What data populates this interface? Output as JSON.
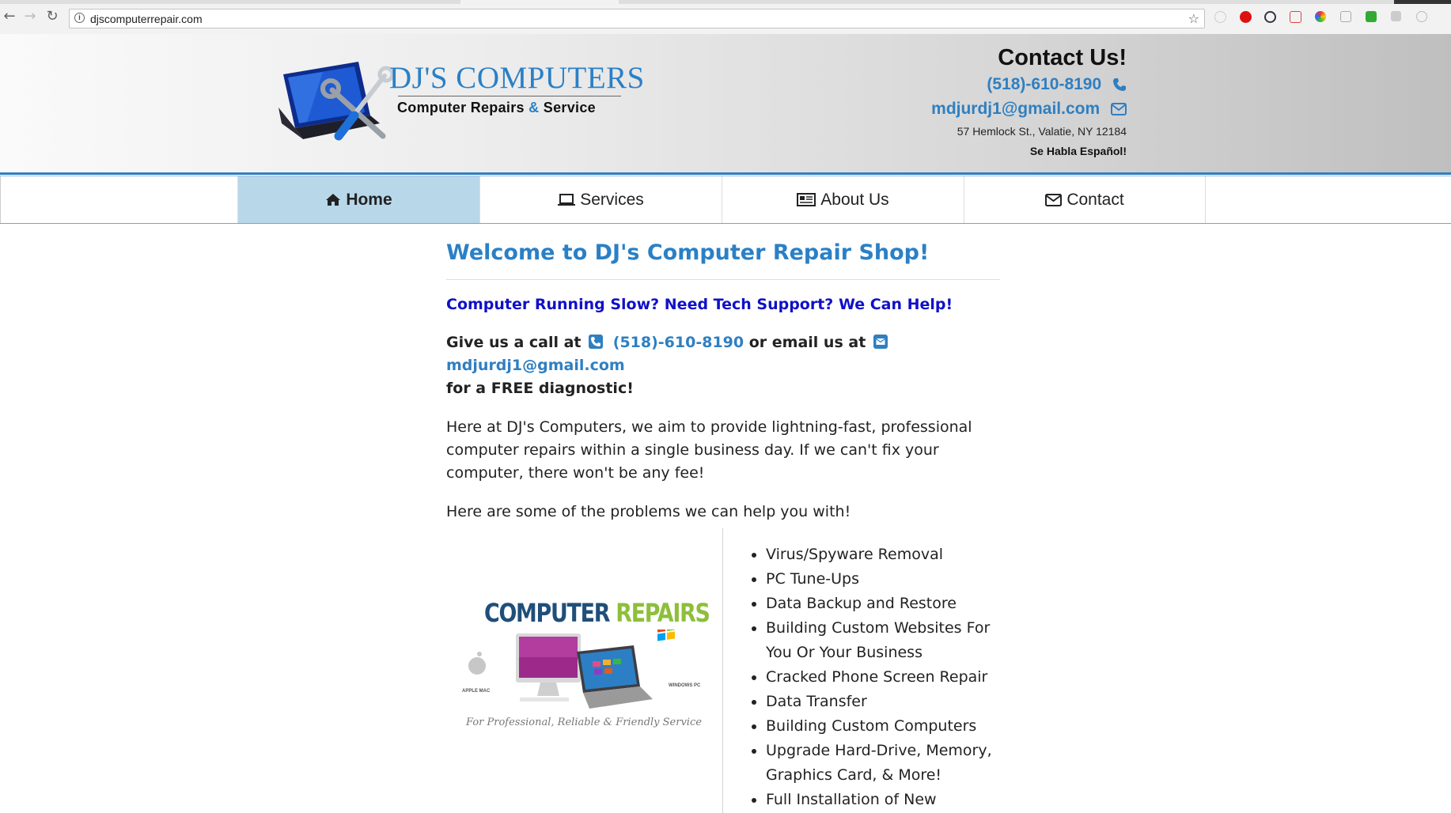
{
  "browser": {
    "url": "djscomputerrepair.com"
  },
  "logo": {
    "title": "DJ'S COMPUTERS",
    "subtitle_part1": "Computer Repairs",
    "subtitle_amp": "&",
    "subtitle_part2": "Service"
  },
  "contact": {
    "title": "Contact Us!",
    "phone": "(518)-610-8190",
    "email": "mdjurdj1@gmail.com",
    "address": "57 Hemlock St., Valatie, NY 12184",
    "spanish": "Se Habla Español!"
  },
  "nav": {
    "items": [
      {
        "label": "Home",
        "icon": "home-icon",
        "active": true
      },
      {
        "label": "Services",
        "icon": "laptop-icon",
        "active": false
      },
      {
        "label": "About Us",
        "icon": "newspaper-icon",
        "active": false
      },
      {
        "label": "Contact",
        "icon": "envelope-icon",
        "active": false
      }
    ]
  },
  "main": {
    "welcome": "Welcome to DJ's Computer Repair Shop!",
    "tagline": "Computer Running Slow? Need Tech Support? We Can Help!",
    "call_prefix": "Give us a call at",
    "call_phone": "(518)-610-8190",
    "call_mid": "or email us at",
    "call_email": "mdjurdj1@gmail.com",
    "call_suffix": "for a FREE diagnostic!",
    "intro": "Here at DJ's Computers, we aim to provide lightning-fast, professional computer repairs within a single business day. If we can't fix your computer, there won't be any fee!",
    "problems_intro": "Here are some of the problems we can help you with!",
    "problems": [
      "Virus/Spyware Removal",
      "PC Tune-Ups",
      "Data Backup and Restore",
      "Building Custom Websites For You Or Your Business",
      "Cracked Phone Screen Repair",
      "Data Transfer",
      "Building Custom Computers",
      "Upgrade Hard-Drive, Memory, Graphics Card, & More!",
      "Full Installation of New"
    ]
  },
  "repairs_image": {
    "title_part1": "COMPUTER",
    "title_part2": "REPAIRS",
    "left_label": "APPLE MAC",
    "right_label": "WINDOWS PC",
    "caption": "For Professional, Reliable & Friendly Service"
  },
  "colors": {
    "accent": "#2a80c6",
    "tagline": "#1010c8",
    "nav_active": "#b8d8ea"
  }
}
